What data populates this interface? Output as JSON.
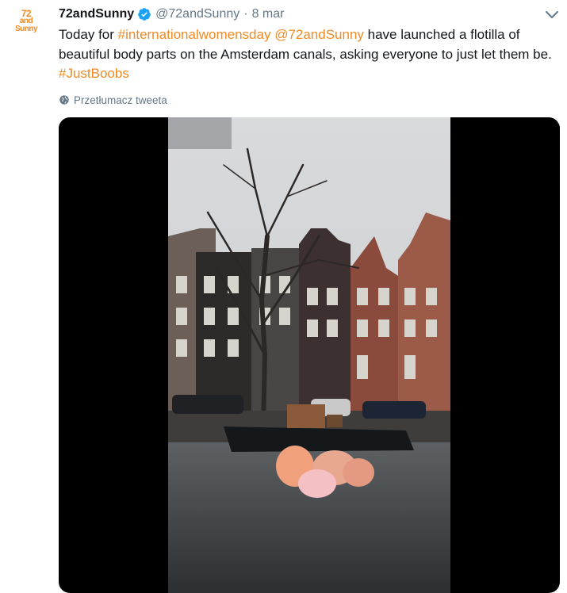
{
  "tweet": {
    "avatar_lines": [
      "72",
      "and",
      "Sunny"
    ],
    "name": "72andSunny",
    "handle": "@72andSunny",
    "separator": "·",
    "date": "8 mar",
    "text_parts": [
      {
        "text": "Today for ",
        "type": "text"
      },
      {
        "text": "#internationalwomensday",
        "type": "link"
      },
      {
        "text": " ",
        "type": "text"
      },
      {
        "text": "@72andSunny",
        "type": "link"
      },
      {
        "text": " have launched a flotilla of beautiful body parts on the Amsterdam canals, asking everyone to just let them be. ",
        "type": "text"
      },
      {
        "text": "#JustBoobs",
        "type": "link"
      }
    ],
    "translate_label": "Przetłumacz tweeta"
  },
  "icons": {
    "verified": "verified-badge-icon",
    "caret": "chevron-down-icon",
    "globe": "globe-icon"
  },
  "colors": {
    "link": "#f08a24",
    "secondary_text": "#657786",
    "verified": "#1da1f2"
  }
}
